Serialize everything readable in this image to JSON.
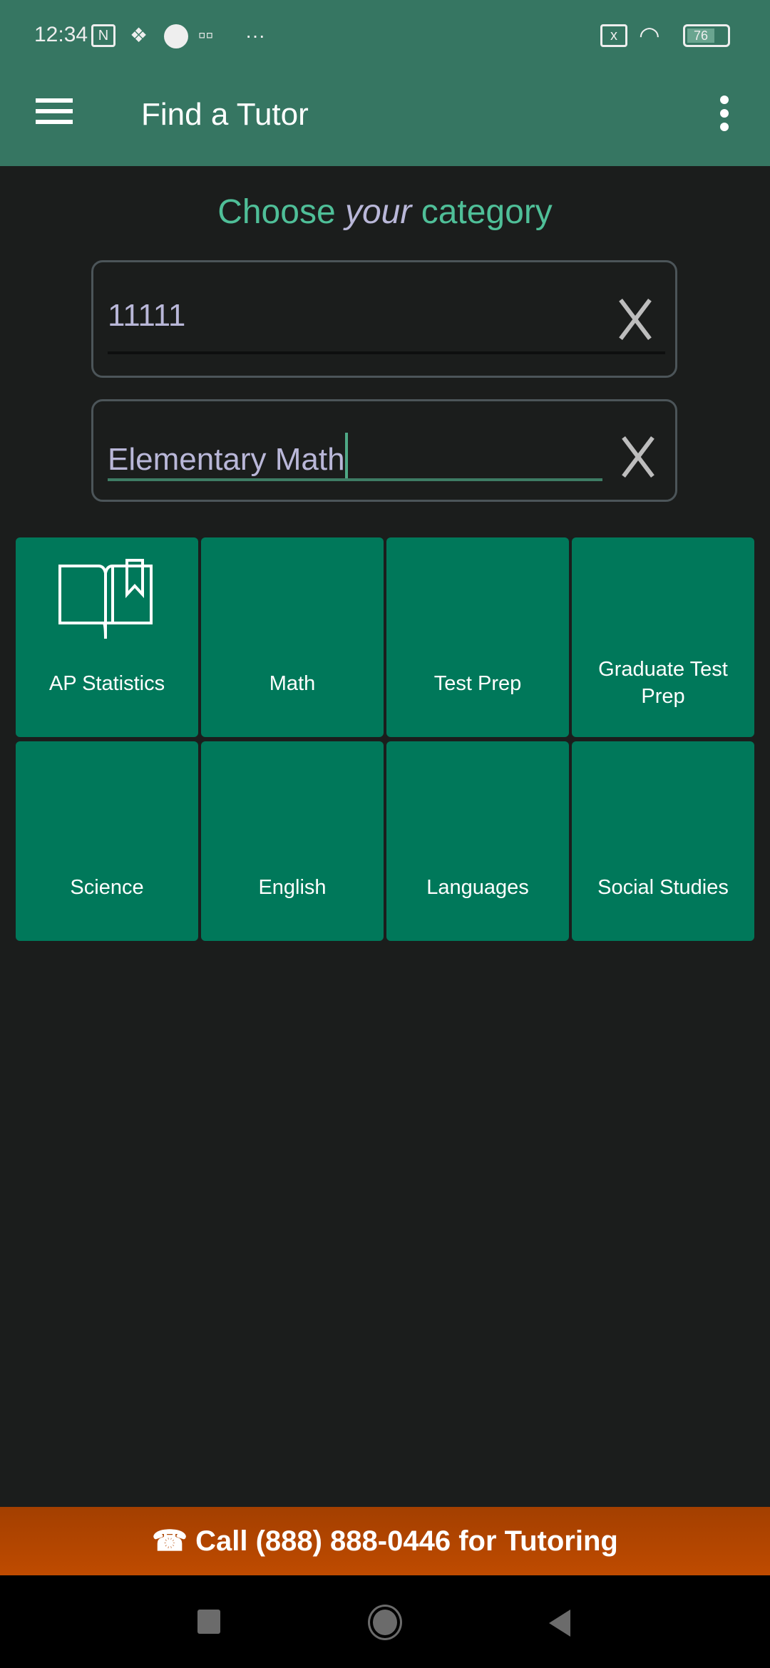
{
  "status_bar": {
    "time": "12:34",
    "battery": "76",
    "more": "···"
  },
  "app_bar": {
    "title": "Find a Tutor"
  },
  "heading": {
    "part1": "Choose",
    "part2": "your",
    "part3": "category"
  },
  "fields": [
    {
      "value": "11111"
    },
    {
      "value": "Elementary Math"
    }
  ],
  "categories": [
    {
      "label": "AP Statistics",
      "icon": "book-icon"
    },
    {
      "label": "Math"
    },
    {
      "label": "Test Prep"
    },
    {
      "label": "Graduate Test Prep"
    },
    {
      "label": "Science"
    },
    {
      "label": "English"
    },
    {
      "label": "Languages"
    },
    {
      "label": "Social Studies"
    }
  ],
  "call_bar": {
    "label": "Call (888) 888-0446 for Tutoring",
    "icon": "phone-icon"
  },
  "colors": {
    "header": "#367662",
    "tile": "#00785a",
    "accent": "#4fbf98",
    "call_bar": "#b34400",
    "background": "#1b1d1c"
  }
}
